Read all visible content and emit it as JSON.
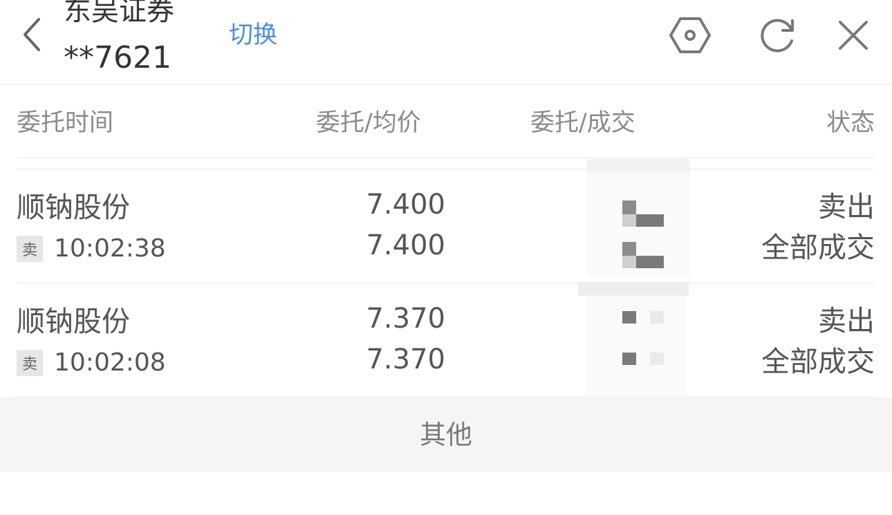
{
  "header": {
    "broker_name": "东吴证券",
    "account": "**7621",
    "switch_label": "切换"
  },
  "columns": {
    "time": "委托时间",
    "price": "委托/均价",
    "qty": "委托/成交",
    "status": "状态"
  },
  "orders": [
    {
      "stock": "顺钠股份",
      "side": "卖",
      "time": "10:02:38",
      "order_price": "7.400",
      "avg_price": "7.400",
      "direction": "卖出",
      "fill_status": "全部成交"
    },
    {
      "stock": "顺钠股份",
      "side": "卖",
      "time": "10:02:08",
      "order_price": "7.370",
      "avg_price": "7.370",
      "direction": "卖出",
      "fill_status": "全部成交"
    }
  ],
  "footer": {
    "label": "其他"
  },
  "colors": {
    "accent": "#4a90d9",
    "text": "#555555",
    "muted": "#8a8a8a",
    "footer_bg": "#f5f5f5"
  },
  "icons": {
    "back": "chevron-left-icon",
    "settings": "hexagon-settings-icon",
    "refresh": "refresh-icon",
    "close": "close-icon"
  }
}
